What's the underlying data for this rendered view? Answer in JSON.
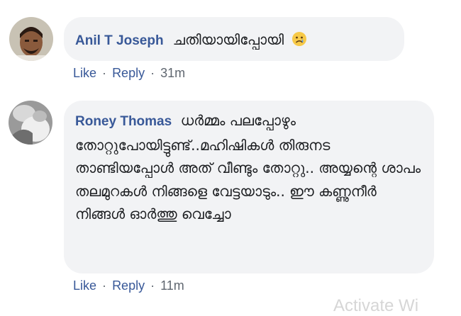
{
  "comments": [
    {
      "author": "Anil T Joseph",
      "text": "ചതിയായിപ്പോയി",
      "emoji": "crying-face-icon",
      "actions": {
        "like": "Like",
        "reply": "Reply",
        "separator": "·",
        "time": "31m"
      }
    },
    {
      "author": "Roney Thomas",
      "text": "ധർമ്മം പലപ്പോഴും തോറ്റുപോയിട്ടുണ്ട്..മഹിഷികൾ തിരുനട താണ്ടിയപ്പോൾ അത് വീണ്ടും തോറ്റു.. അയ്യന്റെ ശാപം തലമുറകൾ നിങ്ങളെ വേട്ടയാടും.. ഈ കണ്ണുനീർ നിങ്ങൾ ഓർത്തു വെച്ചോ",
      "actions": {
        "like": "Like",
        "reply": "Reply",
        "separator": "·",
        "time": "11m"
      }
    }
  ],
  "watermark": "Activate Wi",
  "colors": {
    "link": "#385898",
    "bubble": "#f2f3f5",
    "muted": "#606770"
  }
}
